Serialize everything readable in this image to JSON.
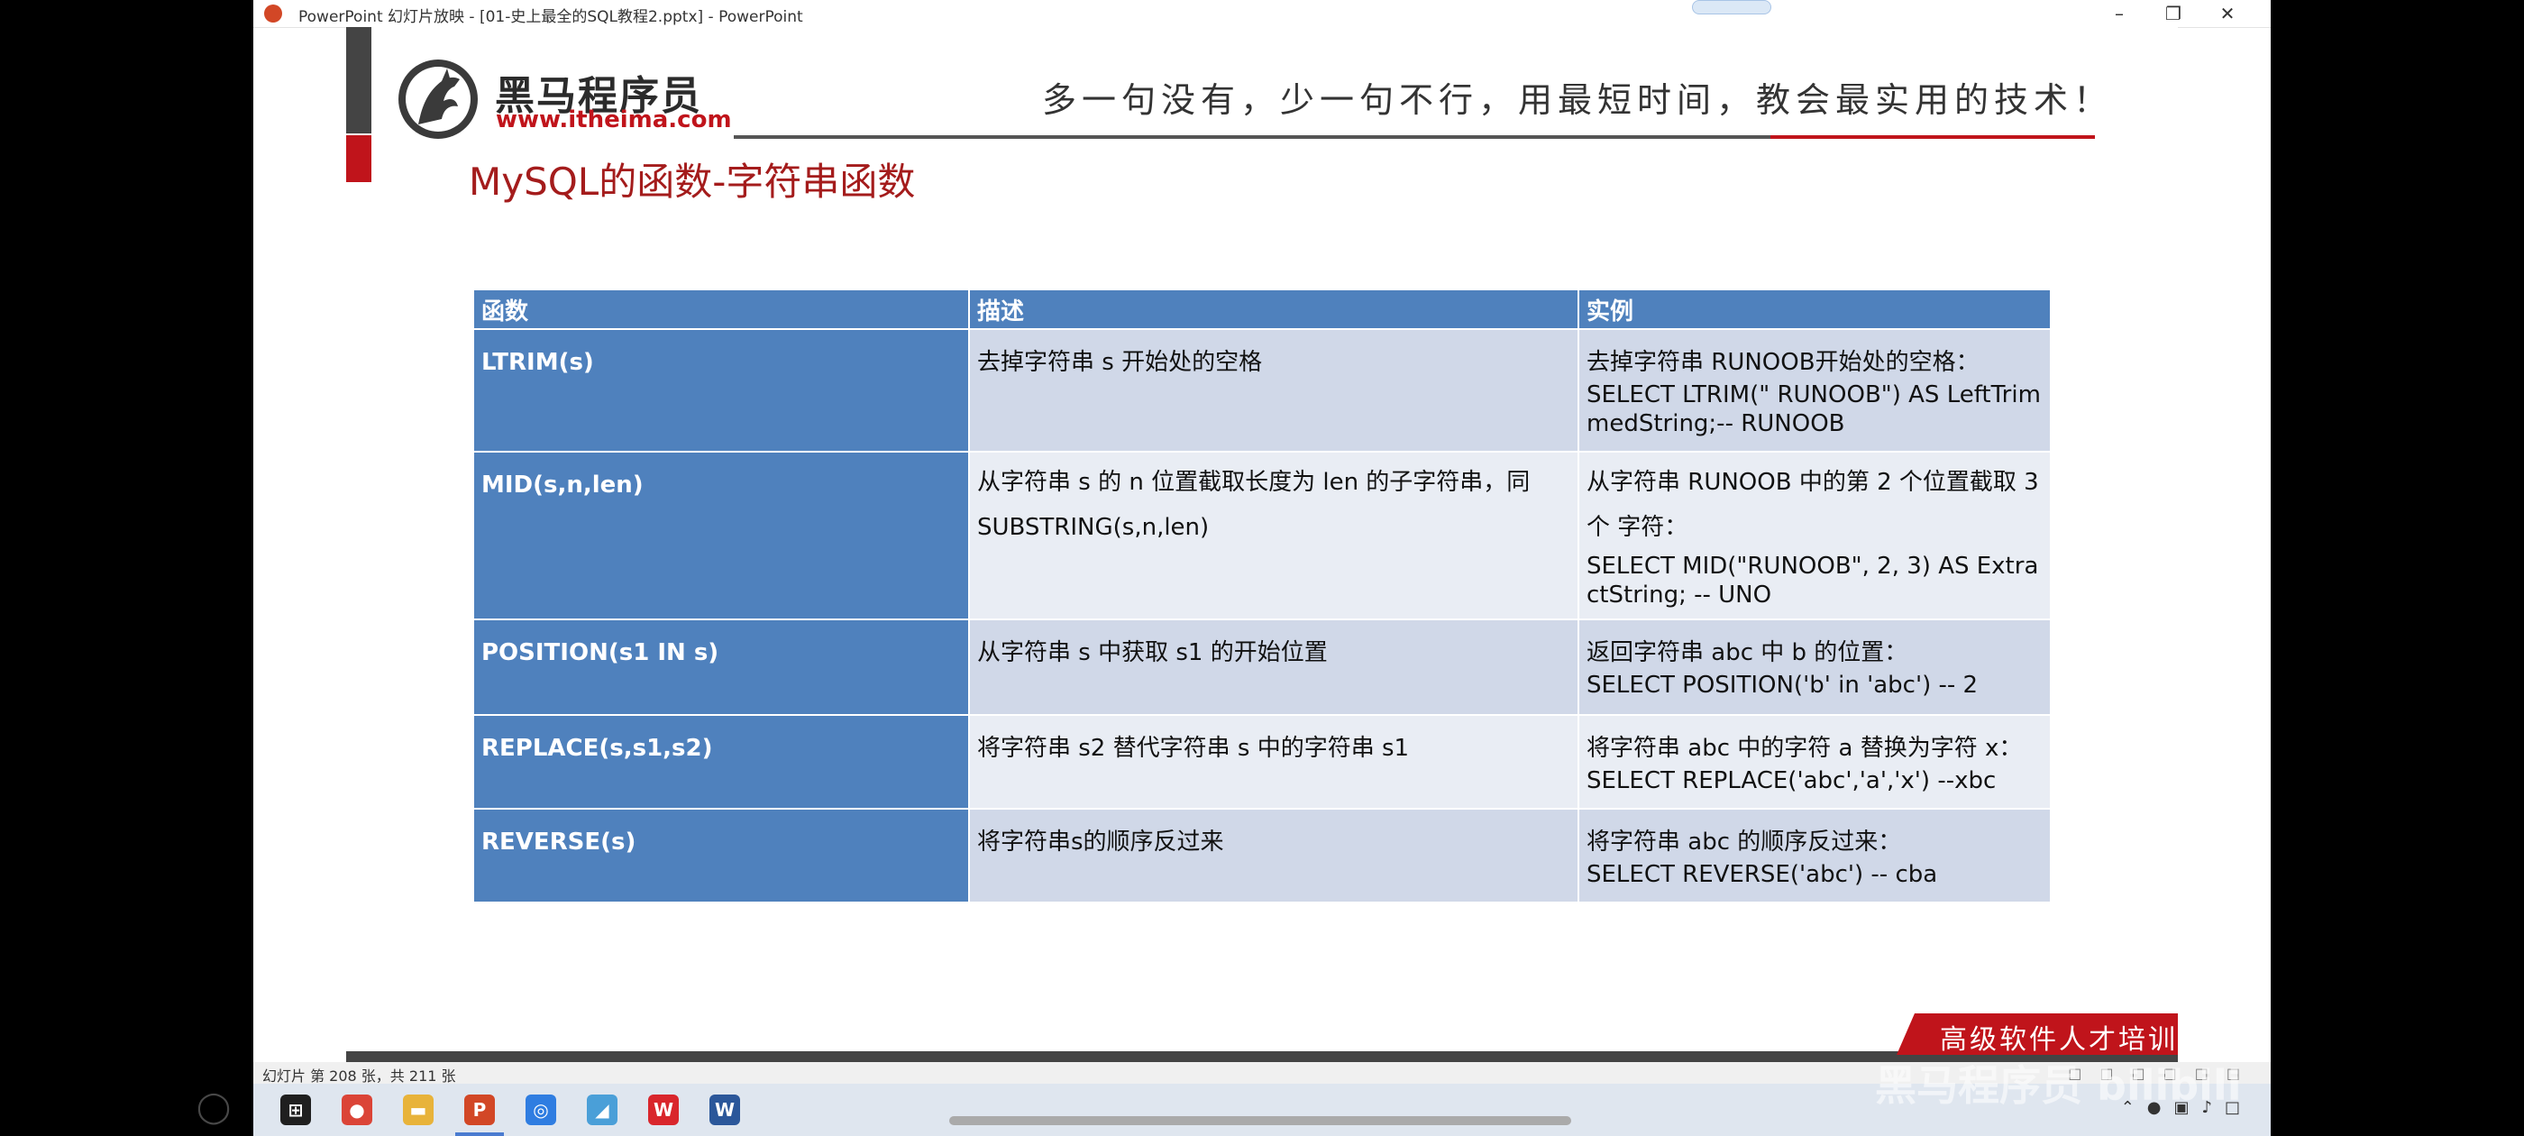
{
  "window": {
    "title": "PowerPoint 幻灯片放映 - [01-史上最全的SQL教程2.pptx] - PowerPoint",
    "minimize_icon": "minimize-icon",
    "restore_icon": "restore-icon",
    "close_icon": "close-icon"
  },
  "slide": {
    "logo_cn": "黑马程序员",
    "logo_url": "www.itheima.com",
    "slogan": "多一句没有，少一句不行，用最短时间，教会最实用的技术！",
    "title": "MySQL的函数-字符串函数",
    "table": {
      "headers": [
        "函数",
        "描述",
        "实例"
      ],
      "rows": [
        {
          "fn": "LTRIM(s)",
          "desc": "去掉字符串 s 开始处的空格",
          "ex_title": "去掉字符串 RUNOOB开始处的空格：",
          "ex_code": "SELECT LTRIM(\"    RUNOOB\") AS LeftTrimmedString;-- RUNOOB"
        },
        {
          "fn": "MID(s,n,len)",
          "desc": "从字符串 s 的 n 位置截取长度为 len 的子字符串，同 SUBSTRING(s,n,len)",
          "ex_title": "从字符串 RUNOOB 中的第 2 个位置截取 3个 字符：",
          "ex_code": "SELECT MID(\"RUNOOB\", 2, 3) AS ExtractString; -- UNO"
        },
        {
          "fn": "POSITION(s1 IN s)",
          "desc": "从字符串 s 中获取 s1 的开始位置",
          "ex_title": "返回字符串 abc 中 b 的位置：",
          "ex_code": "SELECT POSITION('b' in 'abc') -- 2"
        },
        {
          "fn": "REPLACE(s,s1,s2)",
          "desc": "将字符串 s2 替代字符串 s 中的字符串 s1",
          "ex_title": "将字符串 abc 中的字符 a 替换为字符 x：",
          "ex_code": "SELECT REPLACE('abc','a','x') --xbc"
        },
        {
          "fn": "REVERSE(s)",
          "desc": "将字符串s的顺序反过来",
          "ex_title": "将字符串 abc 的顺序反过来：",
          "ex_code": "SELECT REVERSE('abc') -- cba"
        }
      ]
    },
    "banner": "高级软件人才培训专家"
  },
  "statusbar": {
    "slide_info": "幻灯片 第 208 张，共 211 张"
  },
  "taskbar": {
    "apps": [
      {
        "name": "start-icon",
        "color": "#1f1f1f",
        "glyph": "⊞"
      },
      {
        "name": "chrome-icon",
        "color": "#db4437",
        "glyph": "●"
      },
      {
        "name": "file-explorer-icon",
        "color": "#e8b33a",
        "glyph": "▬"
      },
      {
        "name": "powerpoint-icon",
        "color": "#d24726",
        "glyph": "P"
      },
      {
        "name": "browser-icon",
        "color": "#2f7de1",
        "glyph": "◎"
      },
      {
        "name": "notes-icon",
        "color": "#4a9fd8",
        "glyph": "◢"
      },
      {
        "name": "wps-icon",
        "color": "#d9262c",
        "glyph": "W"
      },
      {
        "name": "word-icon",
        "color": "#2b579a",
        "glyph": "W"
      }
    ]
  },
  "watermark": {
    "text": "黑马程序员 bilibili"
  },
  "colors": {
    "accent_red": "#c0141b",
    "title_red": "#a41c1c",
    "table_blue": "#4f81bd",
    "row_odd": "#d0d8e8",
    "row_even": "#e9edf4"
  }
}
